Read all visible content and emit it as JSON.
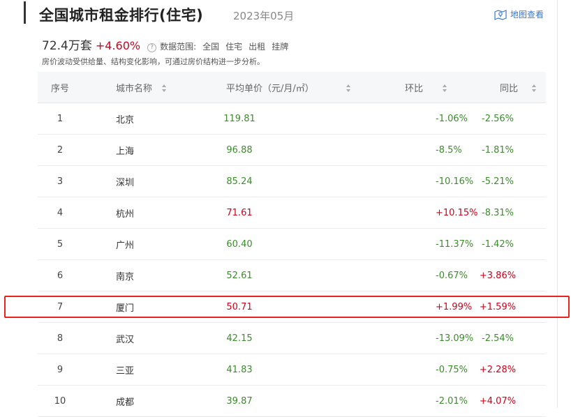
{
  "header": {
    "title": "全国城市租金排行(住宅)",
    "date": "2023年05月",
    "map_link": "地图查看"
  },
  "summary": {
    "total": "72.4万套",
    "change": "+4.60%",
    "help_icon_text": "?",
    "scope_label": "数据范围:",
    "scope_items": [
      "全国",
      "住宅",
      "出租",
      "挂牌"
    ],
    "note": "房价波动受供给量、结构变化影响，可通过房价结构进一步分析。"
  },
  "table": {
    "headers": {
      "rank": "序号",
      "city": "城市名称",
      "price": "平均单价（元/月/㎡）",
      "mom": "环比",
      "yoy": "同比"
    },
    "rows": [
      {
        "rank": "1",
        "city": "北京",
        "price": "119.81",
        "mom": "-1.06%",
        "yoy": "-2.56%"
      },
      {
        "rank": "2",
        "city": "上海",
        "price": "96.88",
        "mom": "-8.5%",
        "yoy": "-1.81%"
      },
      {
        "rank": "3",
        "city": "深圳",
        "price": "85.24",
        "mom": "-10.16%",
        "yoy": "-5.21%"
      },
      {
        "rank": "4",
        "city": "杭州",
        "price": "71.61",
        "mom": "+10.15%",
        "yoy": "-8.31%"
      },
      {
        "rank": "5",
        "city": "广州",
        "price": "60.40",
        "mom": "-11.37%",
        "yoy": "-1.42%"
      },
      {
        "rank": "6",
        "city": "南京",
        "price": "52.61",
        "mom": "-0.67%",
        "yoy": "+3.86%"
      },
      {
        "rank": "7",
        "city": "厦门",
        "price": "50.71",
        "mom": "+1.99%",
        "yoy": "+1.59%"
      },
      {
        "rank": "8",
        "city": "武汉",
        "price": "42.15",
        "mom": "-13.09%",
        "yoy": "-2.54%"
      },
      {
        "rank": "9",
        "city": "三亚",
        "price": "41.83",
        "mom": "-0.75%",
        "yoy": "+2.28%"
      },
      {
        "rank": "10",
        "city": "成都",
        "price": "39.87",
        "mom": "-2.01%",
        "yoy": "+4.07%"
      }
    ]
  },
  "colors": {
    "rise": "#d0021b",
    "fall": "#3a8d2a",
    "highlight_border": "#e8231b"
  }
}
